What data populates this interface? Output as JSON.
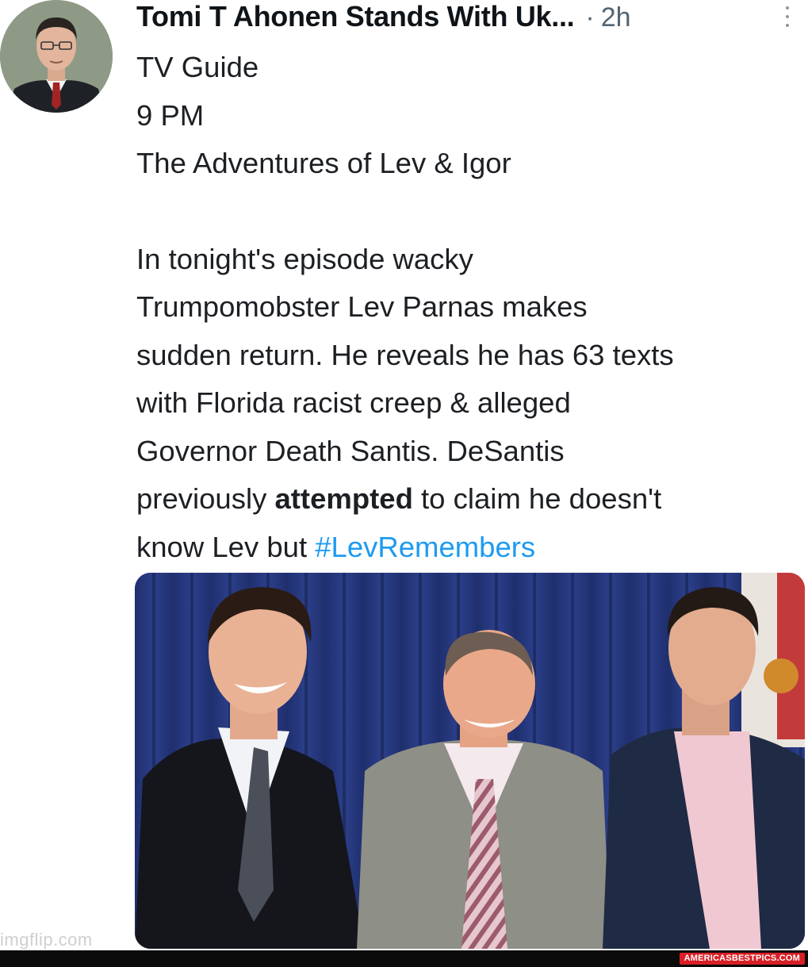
{
  "tweet": {
    "author_name": "Tomi T Ahonen Stands With Uk...",
    "separator": "·",
    "timestamp": "2h",
    "more_icon": "more-vertical-icon",
    "lines": [
      "TV Guide",
      "9 PM",
      "The Adventures of Lev & Igor",
      "",
      "In tonight's episode wacky",
      "Trumpomobster Lev Parnas makes",
      "sudden return. He reveals he has 63 texts",
      "with Florida racist creep & alleged",
      "Governor Death Santis. DeSantis"
    ],
    "line10": {
      "before": "previously ",
      "bold": "attempted",
      "after": " to claim he doesn't"
    },
    "line11": {
      "before": "know Lev but ",
      "hashtag": "#LevRemembers"
    }
  },
  "watermark": "imgflip.com",
  "footer_badge": "AMERICASBESTPICS.COM",
  "colors": {
    "hashtag": "#1d9bf0",
    "meta": "#536471",
    "badge": "#d81f26"
  }
}
